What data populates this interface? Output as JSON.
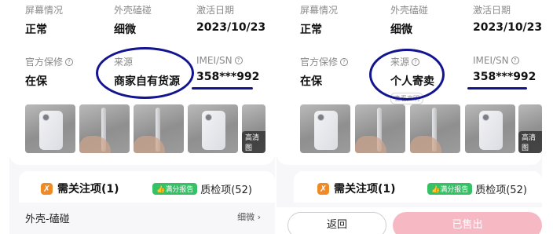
{
  "left": {
    "screen_label": "屏幕情况",
    "screen_value": "正常",
    "shell_label": "外壳磕碰",
    "shell_value": "细微",
    "activation_label": "激活日期",
    "activation_value": "2023/10/23",
    "warranty_label": "官方保修",
    "warranty_value": "在保",
    "source_label": "来源",
    "source_value": "商家自有货源",
    "imei_label": "IMEI/SN",
    "imei_value": "358***992",
    "hd_badge": "高清图",
    "tab_notes": "需关注项(1)",
    "tab_badge": "满分报告",
    "tab_inspections": "质检项(52)",
    "row_label": "外壳-磕碰",
    "row_value": "细微 ›"
  },
  "right": {
    "screen_label": "屏幕情况",
    "screen_value": "正常",
    "shell_label": "外壳磕碰",
    "shell_value": "细微",
    "activation_label": "激活日期",
    "activation_value": "2023/10/23",
    "warranty_label": "官方保修",
    "warranty_value": "在保",
    "source_label": "来源",
    "source_value": "个人寄卖",
    "source_link": "查看声明",
    "imei_label": "IMEI/SN",
    "imei_value": "358***992",
    "hd_badge": "高清图",
    "tab_notes": "需关注项(1)",
    "tab_badge": "满分报告",
    "tab_inspections": "质检项(52)",
    "back_button": "返回",
    "sold_button": "已售出"
  },
  "icons": {
    "question": "question-circle-icon",
    "notes": "warning-badge-icon",
    "thumb": "thumb-up-icon"
  },
  "colors": {
    "annotation": "#13148f",
    "accent_orange": "#f08a24",
    "badge_green": "#35c165",
    "sold_pink": "#f6b9c4"
  }
}
